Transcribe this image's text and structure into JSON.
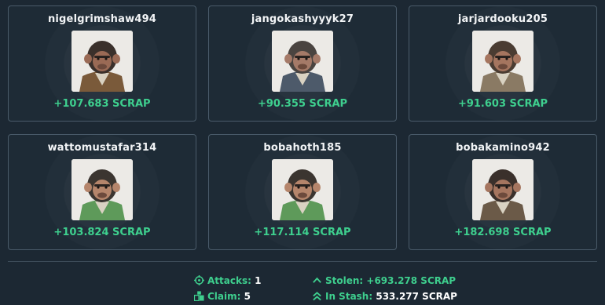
{
  "players": [
    {
      "username": "nigelgrimshaw494",
      "gain": "+107.683 SCRAP",
      "jacket": "#7a5a3a",
      "fur": "#3a302b",
      "face": "#9a6a55"
    },
    {
      "username": "jangokashyyyk27",
      "gain": "+90.355 SCRAP",
      "jacket": "#4d5a6a",
      "fur": "#4a4440",
      "face": "#a57a68"
    },
    {
      "username": "jarjardooku205",
      "gain": "+91.603 SCRAP",
      "jacket": "#8a7a64",
      "fur": "#4a3c32",
      "face": "#a5755f"
    },
    {
      "username": "wattomustafar314",
      "gain": "+103.824 SCRAP",
      "jacket": "#5e9a5a",
      "fur": "#3b3530",
      "face": "#b5856b"
    },
    {
      "username": "bobahoth185",
      "gain": "+117.114 SCRAP",
      "jacket": "#5e9a5a",
      "fur": "#3b3530",
      "face": "#b5856b"
    },
    {
      "username": "bobakamino942",
      "gain": "+182.698 SCRAP",
      "jacket": "#6b5a48",
      "fur": "#3a302b",
      "face": "#a5755f"
    }
  ],
  "stats": {
    "attacks_label": "Attacks:",
    "attacks_value": "1",
    "claim_label": "Claim:",
    "claim_value": "5",
    "stolen_label": "Stolen:",
    "stolen_value": "+693.278 SCRAP",
    "stash_label": "In Stash:",
    "stash_value": "533.277 SCRAP"
  },
  "colors": {
    "accent_green": "#3ecf8e",
    "card_border": "#4a5b6a",
    "background": "#1c2833"
  },
  "icons": {
    "attacks": "crosshair-icon",
    "claim": "blocks-icon",
    "stolen": "chevron-up-icon",
    "stash": "double-chevron-up-icon"
  }
}
